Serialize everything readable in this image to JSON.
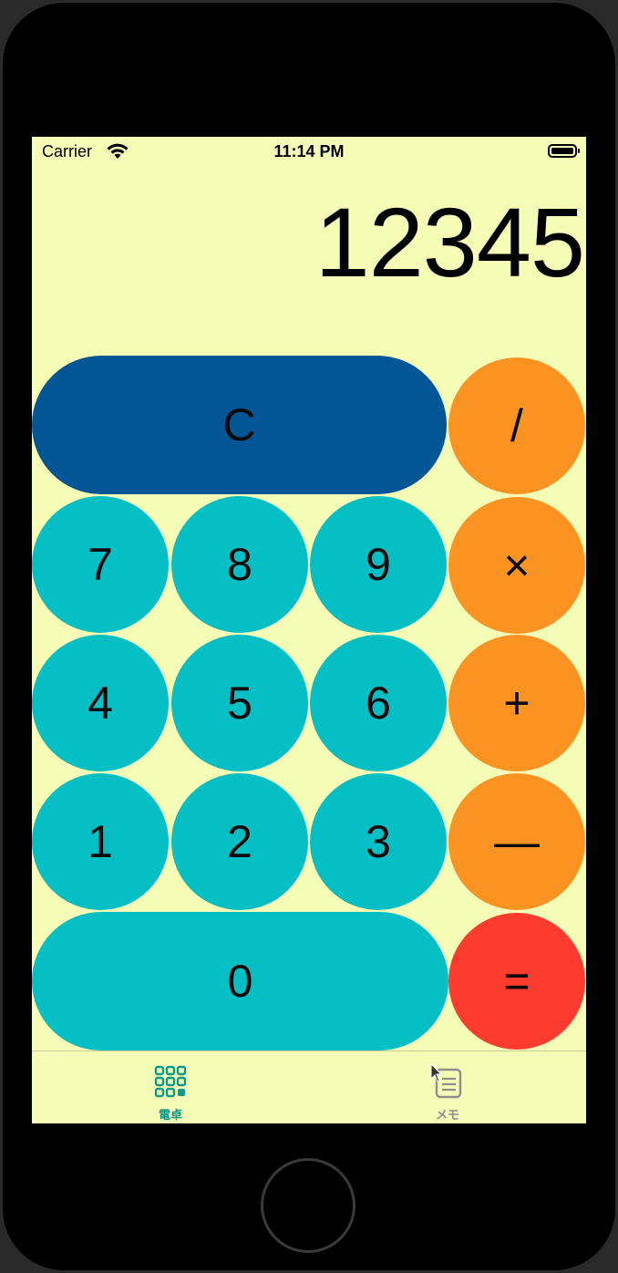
{
  "status_bar": {
    "carrier": "Carrier",
    "time": "11:14 PM"
  },
  "display": {
    "value": "12345"
  },
  "keypad": {
    "clear": "C",
    "divide": "/",
    "multiply": "×",
    "add": "+",
    "subtract": "—",
    "equals": "=",
    "digits": {
      "seven": "7",
      "eight": "8",
      "nine": "9",
      "four": "4",
      "five": "5",
      "six": "6",
      "one": "1",
      "two": "2",
      "three": "3",
      "zero": "0"
    }
  },
  "tabbar": {
    "tabs": [
      {
        "label": "電卓",
        "icon": "grid-icon",
        "selected": true
      },
      {
        "label": "メモ",
        "icon": "memo-icon",
        "selected": false
      }
    ]
  },
  "colors": {
    "background": "#f5fcb6",
    "digit_key": "#05bfc5",
    "operator_key": "#fb9323",
    "equals_key": "#fd3b2f",
    "clear_key": "#035695",
    "tab_selected": "#0e9a8a",
    "tab_unselected": "#8e8e8e"
  }
}
